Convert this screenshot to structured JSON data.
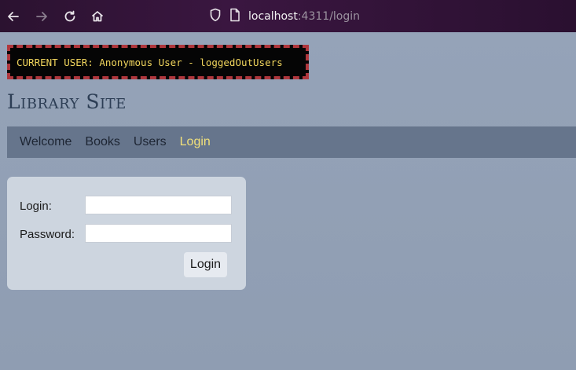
{
  "browser": {
    "url_host": "localhost",
    "url_rest": ":4311/login",
    "icons": [
      "back-arrow-icon",
      "forward-arrow-icon",
      "reload-icon",
      "home-icon",
      "shield-icon",
      "page-icon"
    ]
  },
  "banner": {
    "text": "CURRENT USER: Anonymous User - loggedOutUsers"
  },
  "site": {
    "title": "Library Site"
  },
  "menu": {
    "items": [
      {
        "label": "Welcome",
        "active": false
      },
      {
        "label": "Books",
        "active": false
      },
      {
        "label": "Users",
        "active": false
      },
      {
        "label": "Login",
        "active": true
      }
    ]
  },
  "login_form": {
    "login_label": "Login:",
    "password_label": "Password:",
    "login_value": "",
    "password_value": "",
    "submit_label": "Login"
  },
  "colors": {
    "page_bg": "#95a3b8",
    "menu_bg": "#66758c",
    "active_menu": "#f1e07a",
    "banner_text": "#f1d55d",
    "banner_border": "#b0373d"
  }
}
